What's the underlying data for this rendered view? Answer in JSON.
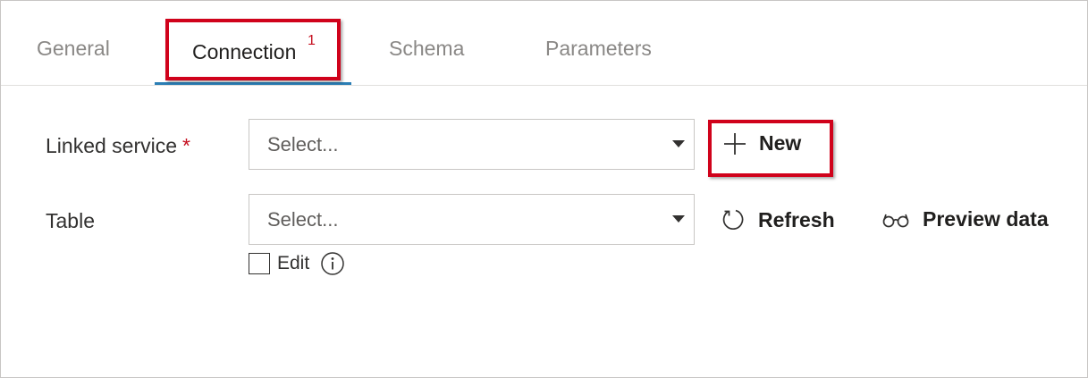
{
  "tabs": {
    "general": "General",
    "connection": "Connection",
    "connection_badge": "1",
    "schema": "Schema",
    "parameters": "Parameters"
  },
  "form": {
    "linked_service_label": "Linked service",
    "required_marker": "*",
    "linked_service_placeholder": "Select...",
    "table_label": "Table",
    "table_placeholder": "Select...",
    "edit_label": "Edit"
  },
  "actions": {
    "new_label": "New",
    "refresh_label": "Refresh",
    "preview_label": "Preview data"
  },
  "icons": {
    "new": "plus-icon",
    "refresh": "refresh-icon",
    "preview": "glasses-icon",
    "info": "info-icon",
    "dropdown": "chevron-down-icon"
  },
  "colors": {
    "highlight": "#d0021b",
    "tab_underline": "#2b7eb5",
    "required": "#c50f1f"
  }
}
